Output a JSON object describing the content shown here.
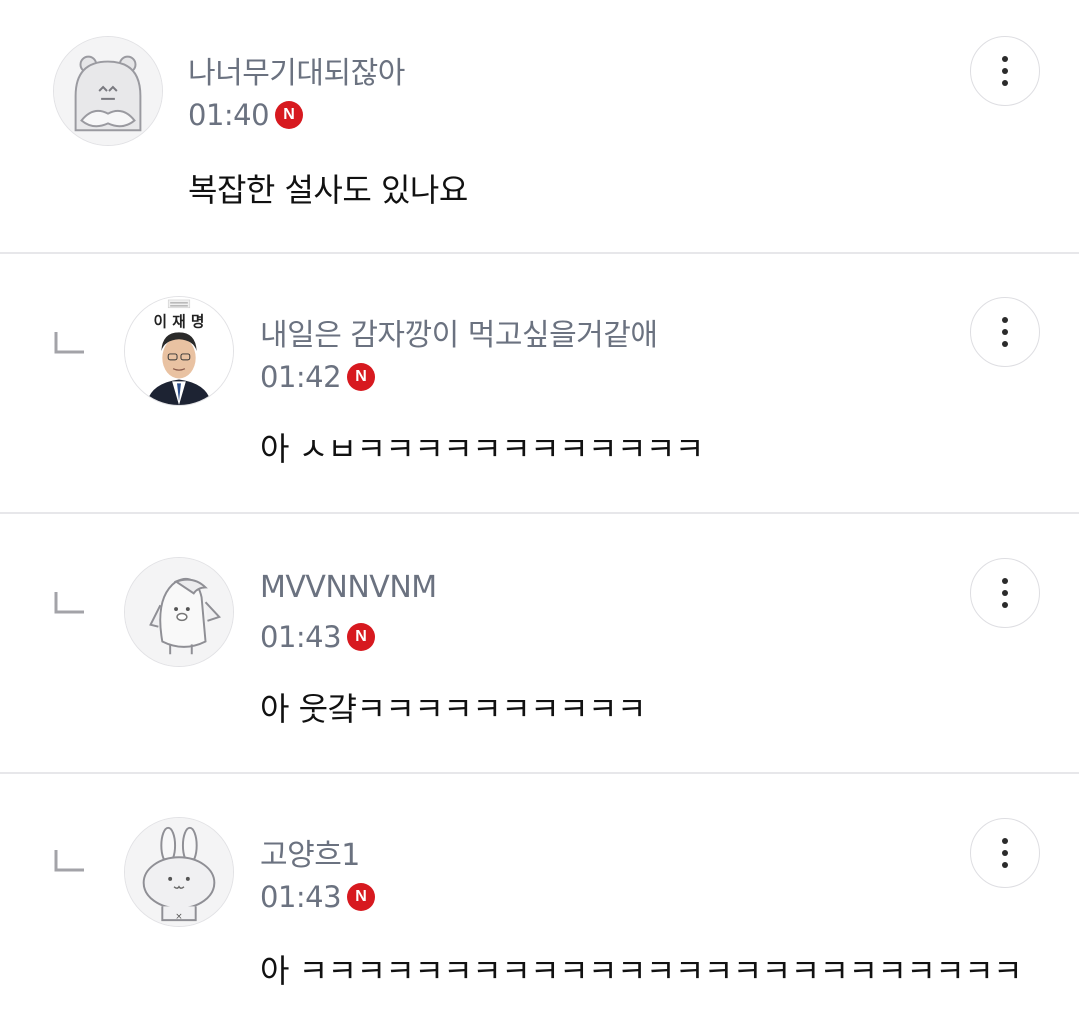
{
  "comments": [
    {
      "nickname": "나너무기대되잖아",
      "time": "01:40",
      "badge": "N",
      "text": "복잡한 설사도 있나요",
      "avatar": "hippo-avatar",
      "is_reply": false
    },
    {
      "nickname": "내일은 감자깡이 먹고싶을거같애",
      "time": "01:42",
      "badge": "N",
      "text": "아 ㅅㅂㅋㅋㅋㅋㅋㅋㅋㅋㅋㅋㅋㅋ",
      "avatar": "politician-photo-avatar",
      "avatar_caption": "이 재 명",
      "is_reply": true
    },
    {
      "nickname": "MVVNNVNM",
      "time": "01:43",
      "badge": "N",
      "text": "아 웃걐ㅋㅋㅋㅋㅋㅋㅋㅋㅋㅋ",
      "avatar": "penguin-avatar",
      "is_reply": true
    },
    {
      "nickname": "고양흐1",
      "time": "01:43",
      "badge": "N",
      "text": "아 ㅋㅋㅋㅋㅋㅋㅋㅋㅋㅋㅋㅋㅋㅋㅋㅋㅋㅋㅋㅋㅋㅋㅋㅋㅋ",
      "avatar": "rabbit-avatar",
      "is_reply": true
    }
  ],
  "colors": {
    "badge": "#d7191f",
    "meta_text": "#6b7280",
    "body_text": "#111111",
    "divider": "#e7e7ea"
  },
  "icons": {
    "more": "more-vertical-icon",
    "reply": "reply-corner-icon"
  }
}
